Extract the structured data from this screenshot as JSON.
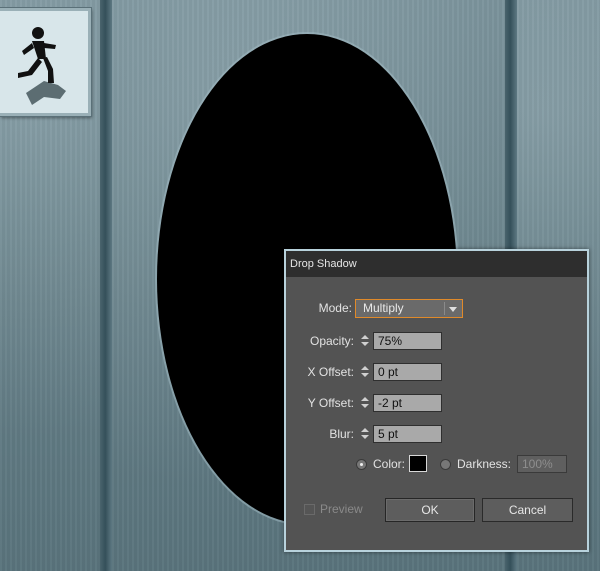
{
  "dialog": {
    "title": "Drop Shadow",
    "mode": {
      "label": "Mode:",
      "value": "Multiply"
    },
    "opacity": {
      "label": "Opacity:",
      "value": "75%"
    },
    "x_offset": {
      "label": "X Offset:",
      "value": "0 pt"
    },
    "y_offset": {
      "label": "Y Offset:",
      "value": "-2 pt"
    },
    "blur": {
      "label": "Blur:",
      "value": "5 pt"
    },
    "color_option": {
      "label": "Color:",
      "selected": true,
      "swatch_color": "#000000"
    },
    "darkness_option": {
      "label": "Darkness:",
      "value": "100%",
      "selected": false
    },
    "preview": {
      "label": "Preview",
      "checked": false
    },
    "ok_label": "OK",
    "cancel_label": "Cancel"
  },
  "colors": {
    "dialog_bg": "#535353",
    "titlebar_bg": "#2e2e2e",
    "dropdown_focus": "#e08a2a",
    "dialog_border": "#b8d2dc"
  },
  "canvas": {
    "sign_icon": "running-figure-icon",
    "portal_shape": "black-ellipse"
  }
}
